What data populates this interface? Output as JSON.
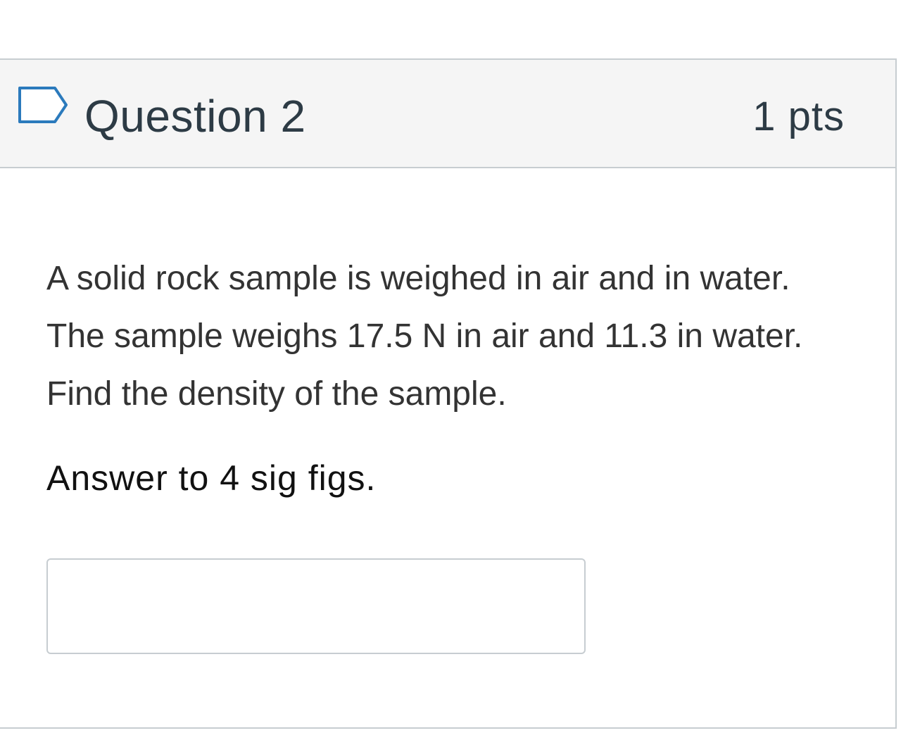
{
  "question": {
    "title": "Question 2",
    "points": "1 pts",
    "flag_icon": "flag-outline-icon",
    "text": "A solid rock sample is weighed in air and in water. The sample weighs 17.5 N in air and 11.3 in water. Find the density of the sample.",
    "instruction": "Answer to 4 sig figs.",
    "answer": {
      "value": "",
      "placeholder": ""
    }
  },
  "colors": {
    "header_background": "#f5f5f5",
    "border": "#c7cdd1",
    "flag_stroke": "#2b7abc",
    "title_text": "#2d3b45"
  }
}
